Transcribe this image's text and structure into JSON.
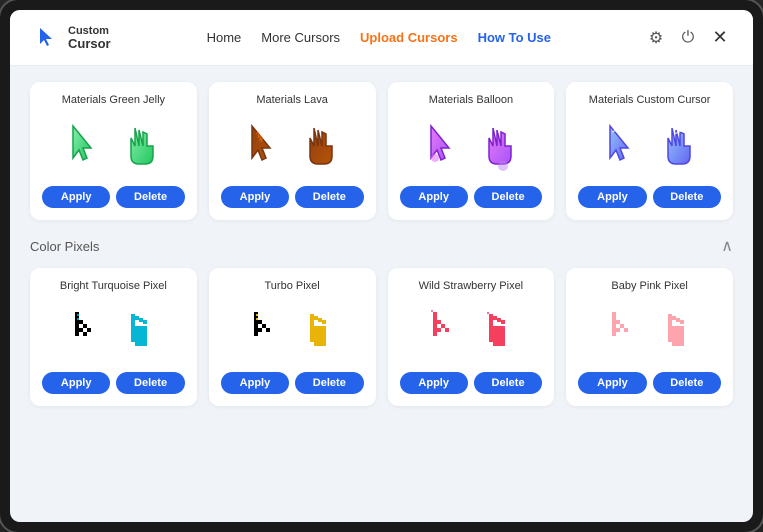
{
  "header": {
    "logo_custom": "Custom",
    "logo_cursor": "Cursor",
    "nav_items": [
      {
        "label": "Home",
        "class": "home"
      },
      {
        "label": "More Cursors",
        "class": "more"
      },
      {
        "label": "Upload Cursors",
        "class": "upload"
      },
      {
        "label": "How To Use",
        "class": "howto"
      }
    ]
  },
  "sections": [
    {
      "id": "materials",
      "title": null,
      "cards": [
        {
          "id": "green-jelly",
          "title": "Materials Green Jelly",
          "colors": [
            "#4ade80",
            "#22c55e"
          ],
          "apply_label": "Apply",
          "delete_label": "Delete"
        },
        {
          "id": "lava",
          "title": "Materials Lava",
          "colors": [
            "#7c3f2e",
            "#b04020"
          ],
          "apply_label": "Apply",
          "delete_label": "Delete"
        },
        {
          "id": "balloon",
          "title": "Materials Balloon",
          "colors": [
            "#c084fc",
            "#a855f7"
          ],
          "apply_label": "Apply",
          "delete_label": "Delete"
        },
        {
          "id": "custom-cursor",
          "title": "Materials Custom Cursor",
          "colors": [
            "#818cf8",
            "#60a5fa"
          ],
          "apply_label": "Apply",
          "delete_label": "Delete"
        }
      ]
    },
    {
      "id": "color-pixels",
      "title": "Color Pixels",
      "cards": [
        {
          "id": "turquoise",
          "title": "Bright Turquoise Pixel",
          "colors": [
            "#06b6d4",
            "#0891b2"
          ],
          "apply_label": "Apply",
          "delete_label": "Delete"
        },
        {
          "id": "turbo",
          "title": "Turbo Pixel",
          "colors": [
            "#facc15",
            "#eab308"
          ],
          "apply_label": "Apply",
          "delete_label": "Delete"
        },
        {
          "id": "strawberry",
          "title": "Wild Strawberry Pixel",
          "colors": [
            "#f43f5e",
            "#ec4899"
          ],
          "apply_label": "Apply",
          "delete_label": "Delete"
        },
        {
          "id": "baby-pink",
          "title": "Baby Pink Pixel",
          "colors": [
            "#fda4af",
            "#fb7185"
          ],
          "apply_label": "Apply",
          "delete_label": "Delete"
        }
      ]
    }
  ],
  "icons": {
    "gear": "⚙",
    "power": "⏻",
    "close": "✕",
    "chevron_up": "∧"
  }
}
